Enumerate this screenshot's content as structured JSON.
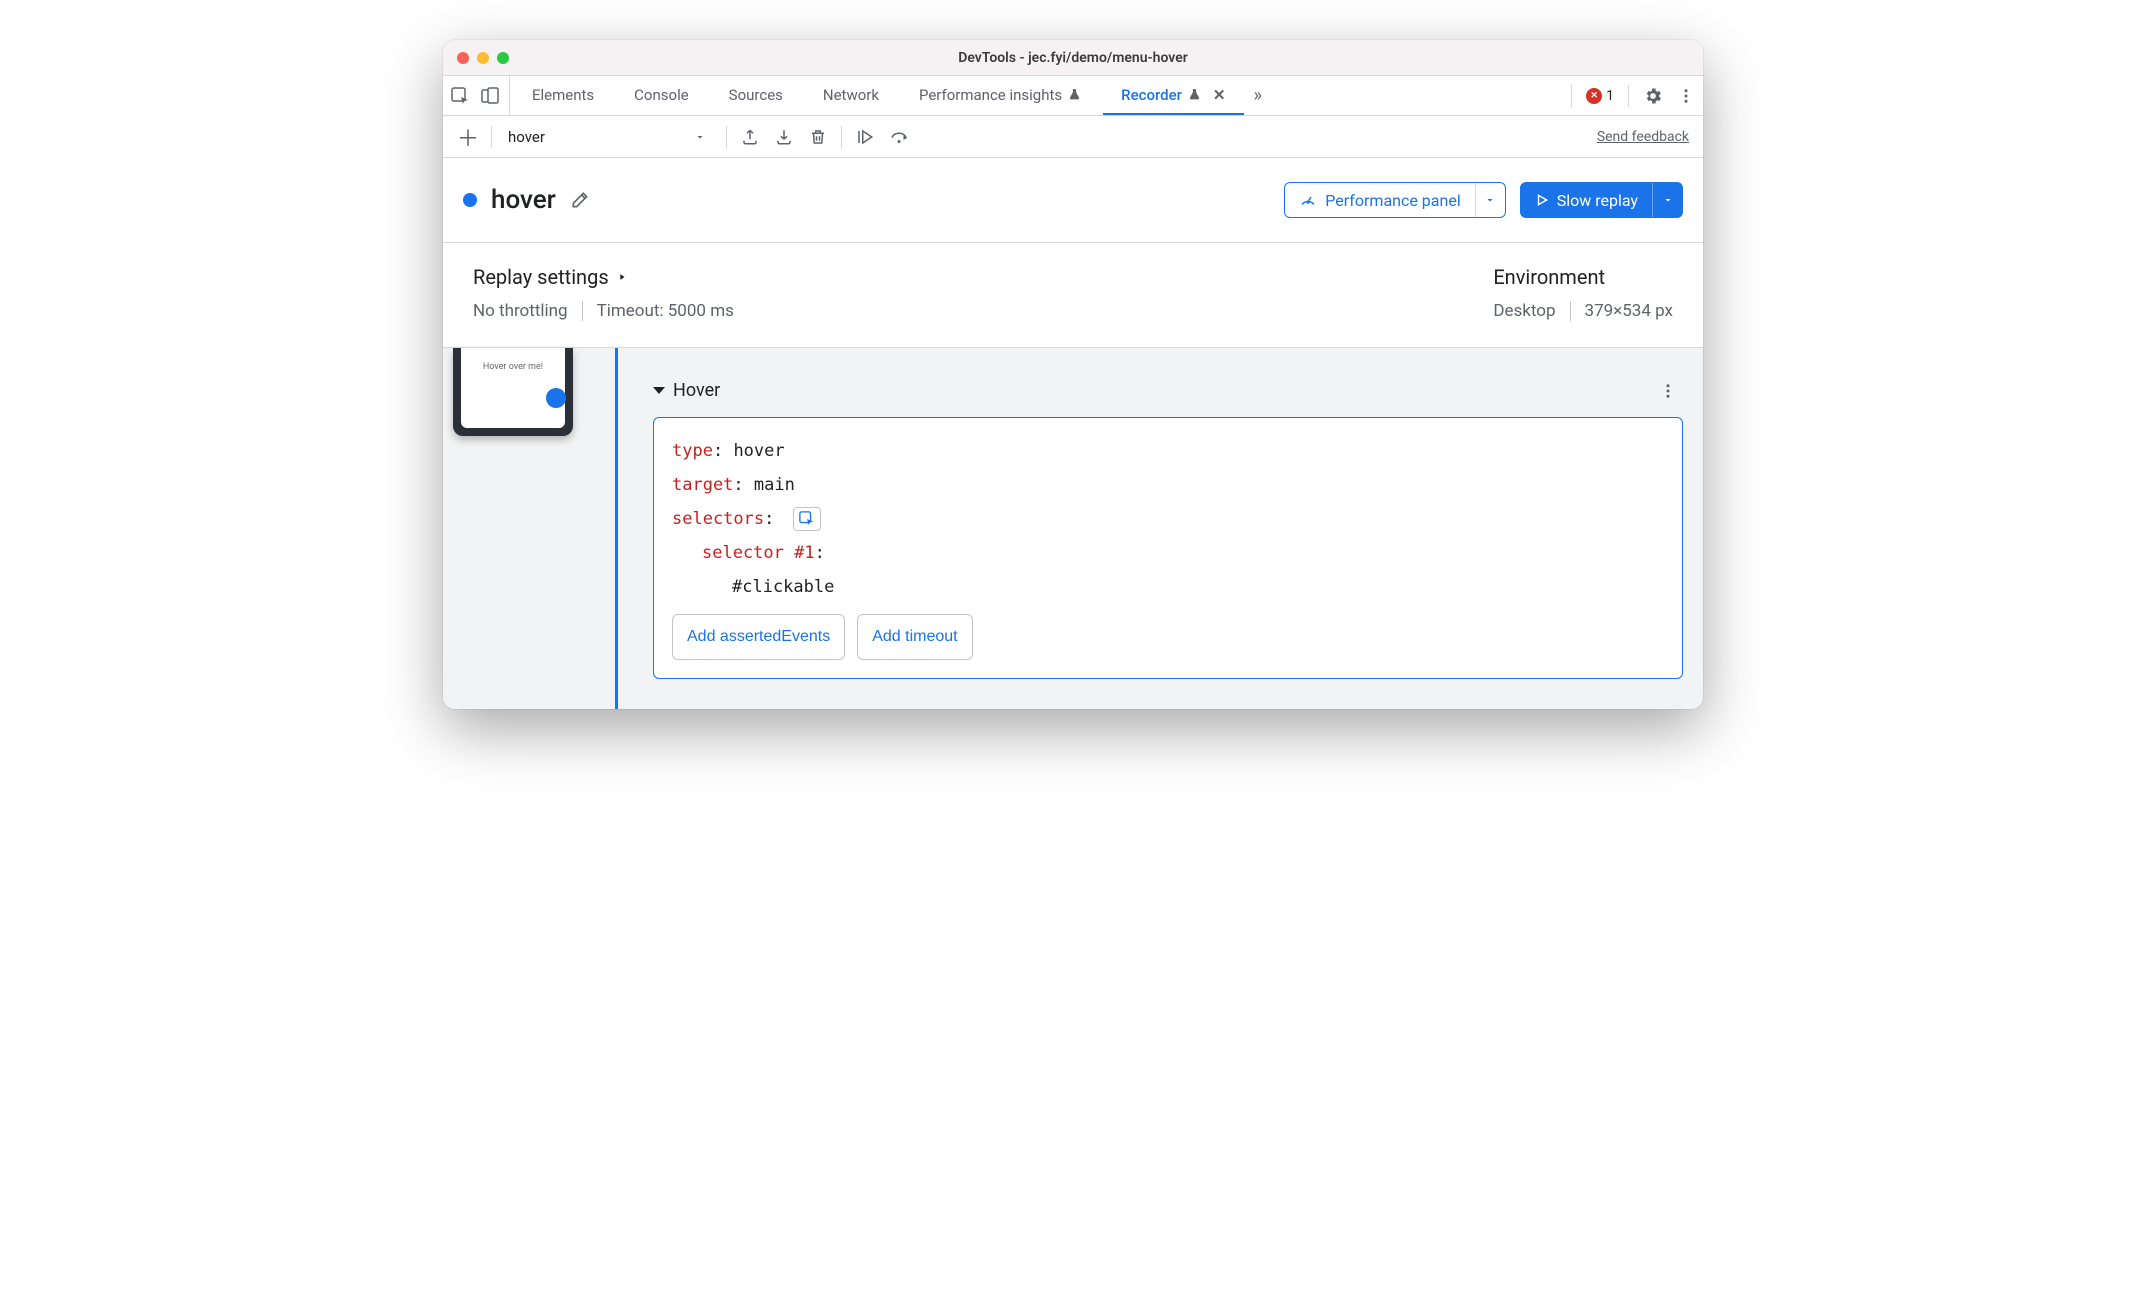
{
  "window": {
    "title": "DevTools - jec.fyi/demo/menu-hover"
  },
  "tabs": {
    "elements": "Elements",
    "console": "Console",
    "sources": "Sources",
    "network": "Network",
    "perf_insights": "Performance insights",
    "recorder": "Recorder"
  },
  "errors": {
    "count": "1"
  },
  "toolbar": {
    "recording_name": "hover",
    "feedback": "Send feedback"
  },
  "header": {
    "title": "hover",
    "perf_panel": "Performance panel",
    "slow_replay": "Slow replay"
  },
  "settings": {
    "replay_heading": "Replay settings",
    "throttling": "No throttling",
    "timeout": "Timeout: 5000 ms",
    "env_heading": "Environment",
    "device": "Desktop",
    "viewport": "379×534 px"
  },
  "thumbnail": {
    "caption": "Hover over me!"
  },
  "step": {
    "name": "Hover",
    "type_key": "type",
    "type_val": "hover",
    "target_key": "target",
    "target_val": "main",
    "selectors_key": "selectors",
    "selector1_key": "selector #1",
    "selector1_val": "#clickable",
    "add_asserted": "Add assertedEvents",
    "add_timeout": "Add timeout"
  }
}
